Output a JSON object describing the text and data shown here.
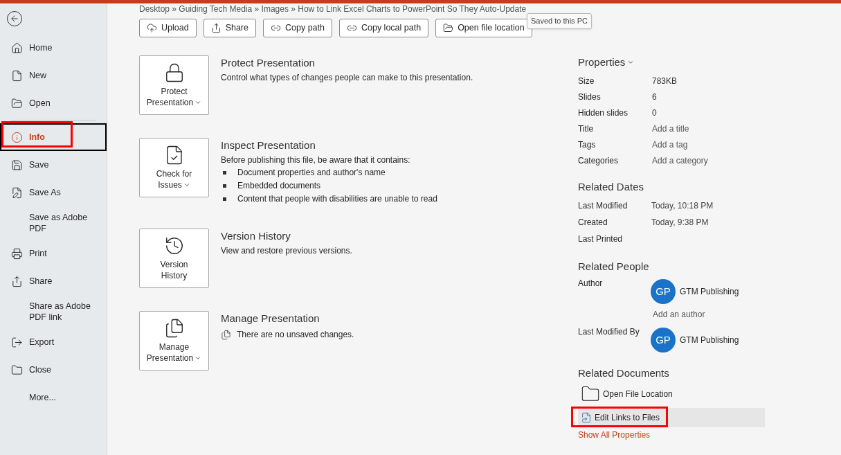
{
  "breadcrumb": "Desktop » Guiding Tech Media » Images » How to Link Excel Charts to PowerPoint So They Auto-Update",
  "tooltip": "Saved to this PC",
  "sidebar": {
    "items": [
      {
        "label": "Home",
        "selected": false,
        "highlighted": false
      },
      {
        "label": "New",
        "selected": false,
        "highlighted": false
      },
      {
        "label": "Open",
        "selected": false,
        "highlighted": false
      },
      {
        "label": "Info",
        "selected": true,
        "highlighted": true
      },
      {
        "label": "Save",
        "selected": false,
        "highlighted": false
      },
      {
        "label": "Save As",
        "selected": false,
        "highlighted": false
      },
      {
        "label": "Save as Adobe PDF",
        "selected": false,
        "highlighted": false
      },
      {
        "label": "Print",
        "selected": false,
        "highlighted": false
      },
      {
        "label": "Share",
        "selected": false,
        "highlighted": false
      },
      {
        "label": "Share as Adobe PDF link",
        "selected": false,
        "highlighted": false
      },
      {
        "label": "Export",
        "selected": false,
        "highlighted": false
      },
      {
        "label": "Close",
        "selected": false,
        "highlighted": false
      },
      {
        "label": "More...",
        "selected": false,
        "highlighted": false
      }
    ]
  },
  "toolbar": [
    {
      "label": "Upload"
    },
    {
      "label": "Share"
    },
    {
      "label": "Copy path"
    },
    {
      "label": "Copy local path"
    },
    {
      "label": "Open file location"
    }
  ],
  "sections": [
    {
      "kind": "text",
      "tile": [
        "Protect",
        "Presentation"
      ],
      "title": "Protect Presentation",
      "description": "Control what types of changes people can make to this presentation."
    },
    {
      "kind": "bullets",
      "tile": [
        "Check for",
        "Issues"
      ],
      "title": "Inspect Presentation",
      "description": "Before publishing this file, be aware that it contains:",
      "bullets": [
        "Document properties and author's name",
        "Embedded documents",
        "Content that people with disabilities are unable to read"
      ]
    },
    {
      "kind": "text",
      "tile": [
        "Version",
        "History"
      ],
      "title": "Version History",
      "description": "View and restore previous versions."
    },
    {
      "kind": "note",
      "tile": [
        "Manage",
        "Presentation"
      ],
      "title": "Manage Presentation",
      "description": "There are no unsaved changes."
    }
  ],
  "properties": {
    "title": "Properties",
    "rows": [
      {
        "label": "Size",
        "value": "783KB",
        "kind": "value"
      },
      {
        "label": "Slides",
        "value": "6",
        "kind": "value"
      },
      {
        "label": "Hidden slides",
        "value": "0",
        "kind": "value"
      },
      {
        "label": "Title",
        "value": "Add a title",
        "kind": "link"
      },
      {
        "label": "Tags",
        "value": "Add a tag",
        "kind": "link"
      },
      {
        "label": "Categories",
        "value": "Add a category",
        "kind": "link"
      }
    ]
  },
  "related_dates": {
    "title": "Related Dates",
    "rows": [
      {
        "label": "Last Modified",
        "value": "Today, 10:18 PM"
      },
      {
        "label": "Created",
        "value": "Today, 9:38 PM"
      },
      {
        "label": "Last Printed"
      }
    ]
  },
  "related_people": {
    "title": "Related People",
    "rows": [
      {
        "label": "Author",
        "initials": "GP",
        "name": "GTM Publishing",
        "add": "Add an author"
      },
      {
        "label": "Last Modified By",
        "initials": "GP",
        "name": "GTM Publishing"
      }
    ]
  },
  "related_documents": {
    "title": "Related Documents",
    "items": [
      {
        "label": "Open File Location",
        "highlighted": false
      },
      {
        "label": "Edit Links to Files",
        "highlighted": true
      }
    ]
  },
  "show_all": "Show All Properties"
}
